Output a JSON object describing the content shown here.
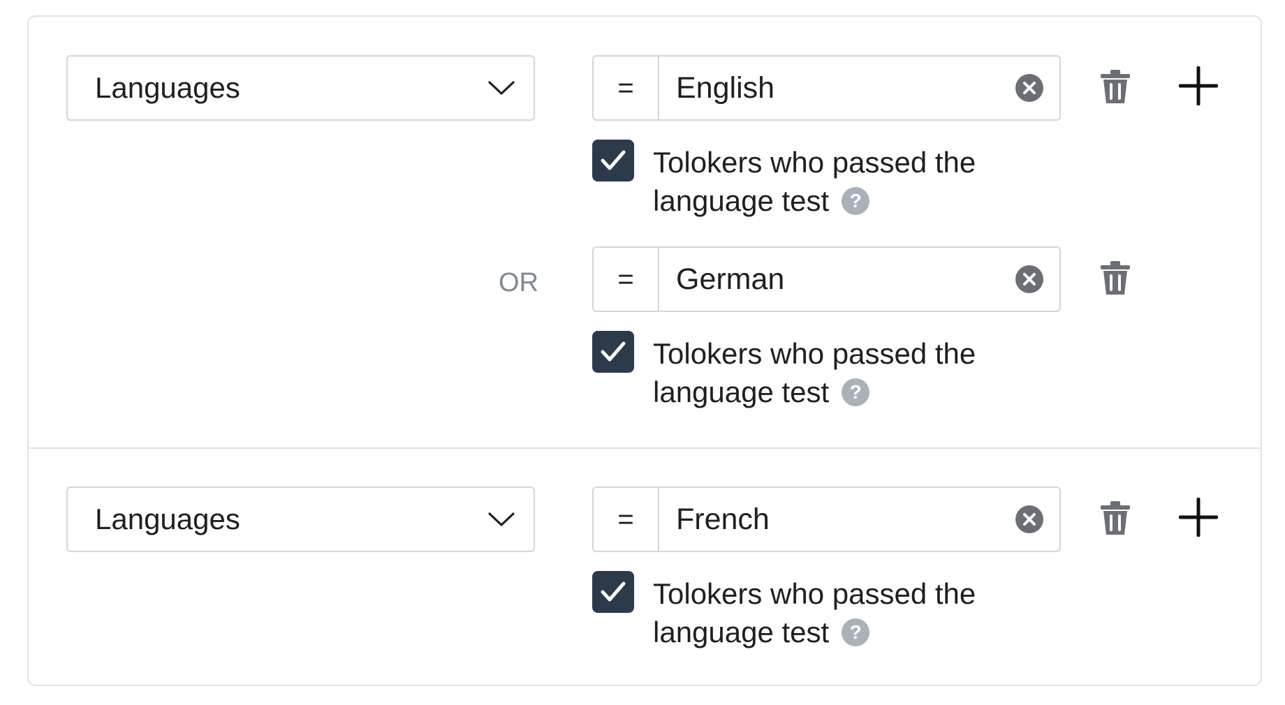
{
  "groups": [
    {
      "field_select": {
        "label": "Languages"
      },
      "conditions": [
        {
          "operator": "=",
          "value": "English",
          "checkbox": {
            "checked": true,
            "label_line1": "Tolokers who passed the",
            "label_line2": "language test",
            "help": "?"
          }
        },
        {
          "connector": "OR",
          "operator": "=",
          "value": "German",
          "checkbox": {
            "checked": true,
            "label_line1": "Tolokers who passed the",
            "label_line2": "language test",
            "help": "?"
          }
        }
      ]
    },
    {
      "field_select": {
        "label": "Languages"
      },
      "conditions": [
        {
          "operator": "=",
          "value": "French",
          "checkbox": {
            "checked": true,
            "label_line1": "Tolokers who passed the",
            "label_line2": "language test",
            "help": "?"
          }
        }
      ]
    }
  ],
  "icons": {
    "dropdown": "chevron-down-icon",
    "clear": "clear-circle-icon",
    "delete": "trash-icon",
    "add": "plus-icon",
    "check": "checkmark-icon",
    "help": "question-circle-icon"
  },
  "colors": {
    "checkbox_bg": "#2c3a4c",
    "border": "#d3d6da",
    "icon_gray": "#6b6f75",
    "help_bg": "#a9b1bb",
    "connector_text": "#808891"
  }
}
